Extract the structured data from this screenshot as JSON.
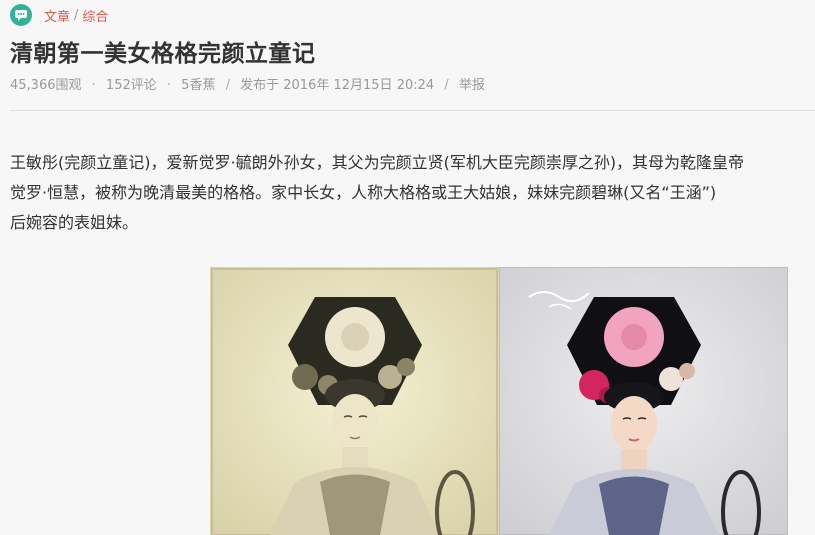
{
  "breadcrumb": {
    "section": "文章",
    "separator": "/",
    "category": "综合"
  },
  "article": {
    "title": "清朝第一美女格格完颜立童记",
    "meta": {
      "views": "45,366围观",
      "comments": "152评论",
      "bananas": "5香蕉",
      "published": "发布于 2016年 12月15日 20:24",
      "report": "举报",
      "dot": "·",
      "slash": "/"
    },
    "paragraph_lines": [
      "王敏彤(完颜立童记)，爱新觉罗·毓朗外孙女，其父为完颜立贤(军机大臣完颜崇厚之孙)，其母为乾隆皇帝",
      "觉罗·恒慧，被称为晚清最美的格格。家中长女，人称大格格或王大姑娘，妹妹完颜碧琳(又名“王涵”)",
      "后婉容的表姐妹。"
    ]
  },
  "colors": {
    "accent": "#e2574c",
    "logo": "#31b399",
    "title": "#333333",
    "meta": "#999999"
  },
  "icons": {
    "site_logo": "chat-bubble-icon"
  }
}
